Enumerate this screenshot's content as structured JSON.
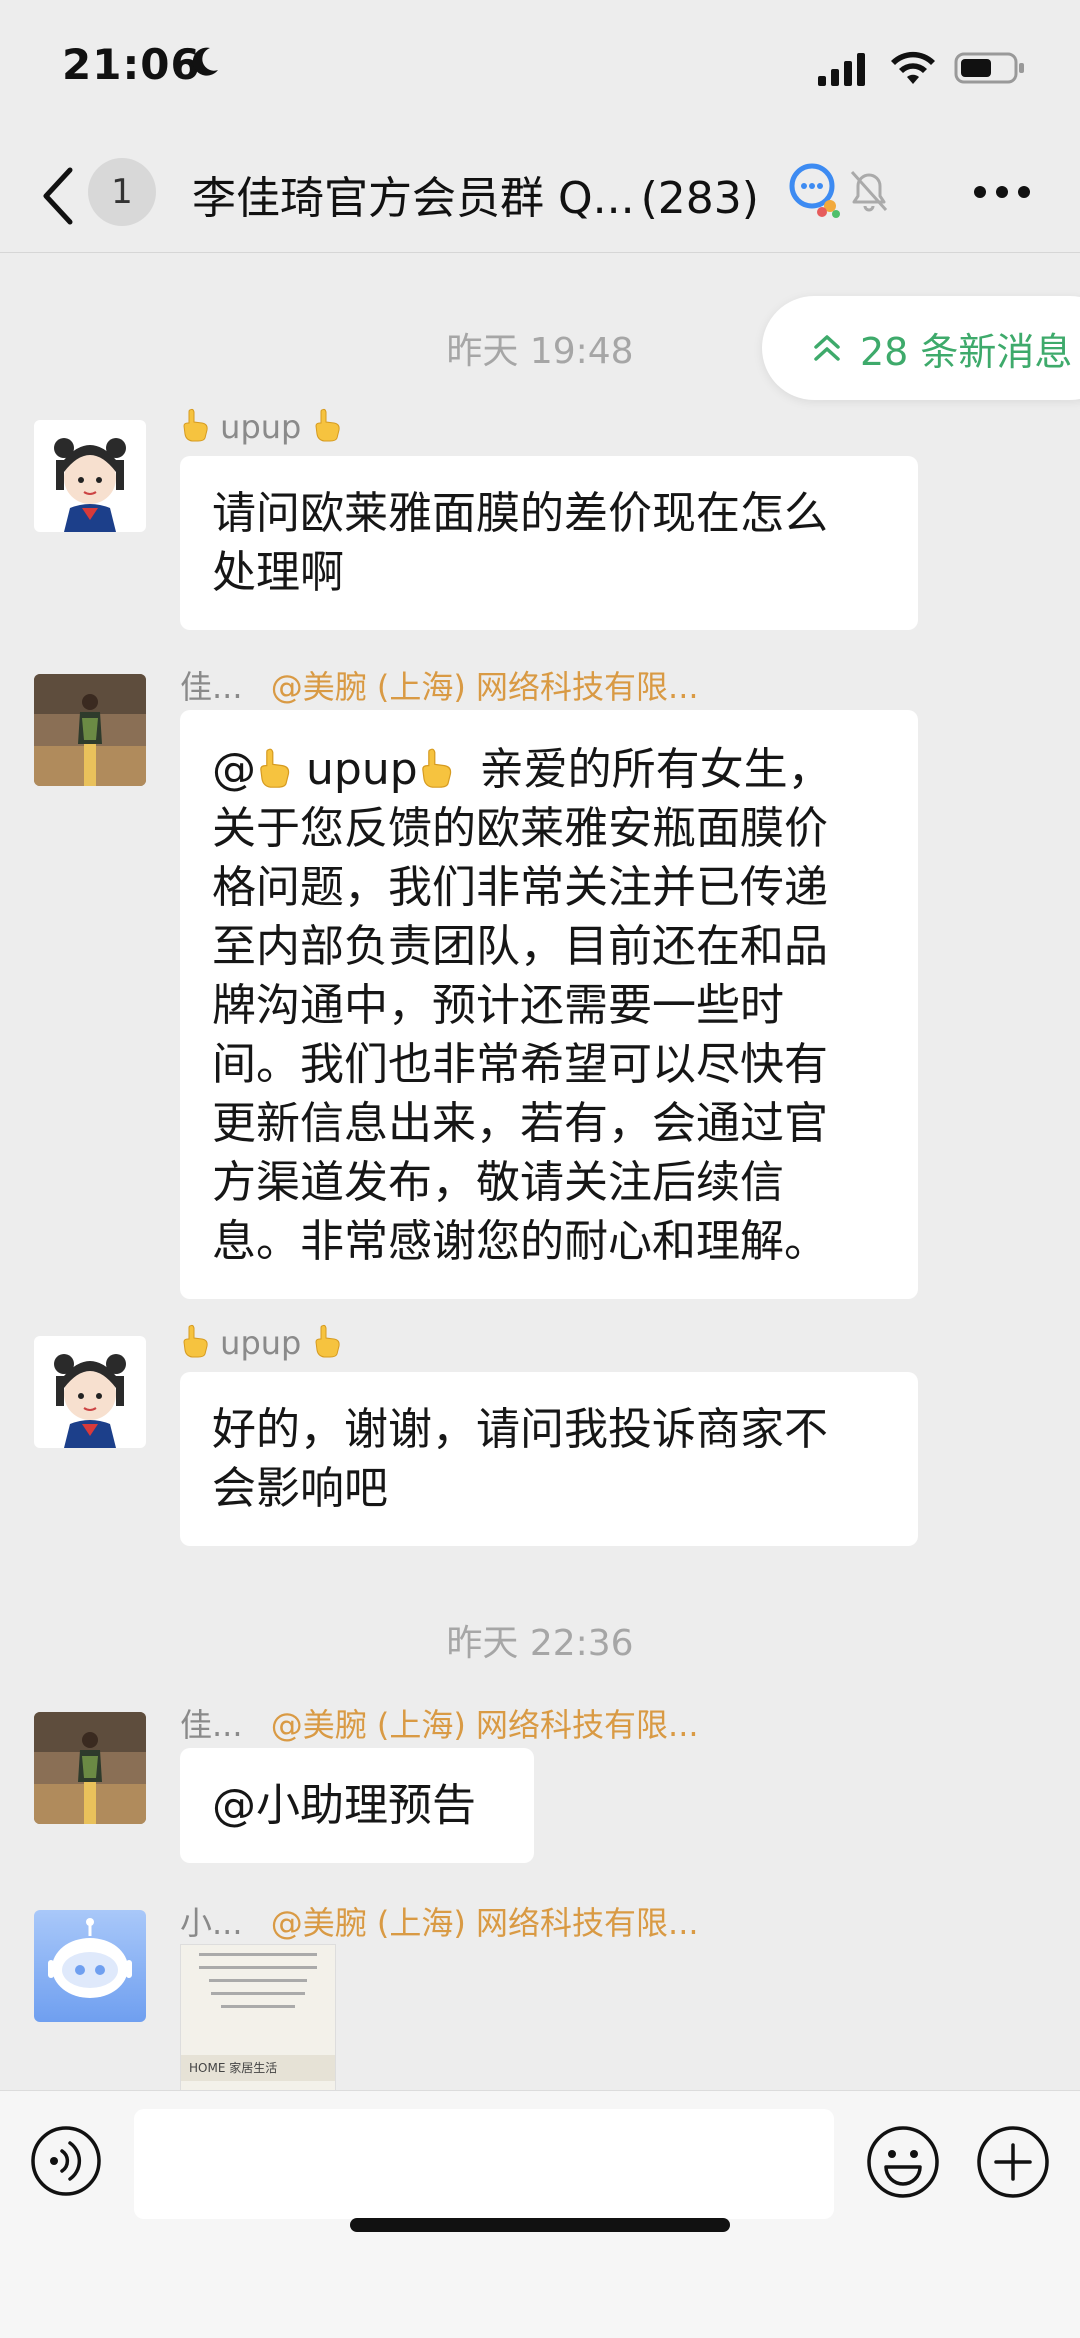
{
  "status_bar": {
    "time": "21:06",
    "icons": [
      "moon-icon",
      "signal-icon",
      "wifi-icon",
      "battery-icon"
    ]
  },
  "nav": {
    "unread_badge": "1",
    "title": "李佳琦官方会员群 Q...",
    "member_count": "(283)",
    "icons": [
      "back-icon",
      "group-chat-icon",
      "mute-icon",
      "more-icon"
    ]
  },
  "new_messages": {
    "label": "28 条新消息"
  },
  "timestamps": {
    "first": "昨天 19:48",
    "second": "昨天 22:36"
  },
  "messages": [
    {
      "sender": "upup",
      "text_line1": "请问欧莱雅面膜的差价现在怎么",
      "text_line2": "处理啊"
    },
    {
      "sender": "佳...",
      "org": "@美腕 (上海) 网络科技有限...",
      "mention": "@",
      "mention_name": "upup",
      "lines": [
        "亲爱的所有女生，",
        "关于您反馈的欧莱雅安瓶面膜价",
        "格问题，我们非常关注并已传递",
        "至内部负责团队，目前还在和品",
        "牌沟通中，预计还需要一些时",
        "间。我们也非常希望可以尽快有",
        "更新信息出来，若有，会通过官",
        "方渠道发布，敬请关注后续信",
        "息。非常感谢您的耐心和理解。"
      ]
    },
    {
      "sender": "upup",
      "text_line1": "好的，谢谢，请问我投诉商家不",
      "text_line2": "会影响吧"
    },
    {
      "sender": "佳...",
      "org": "@美腕 (上海) 网络科技有限...",
      "text": "@小助理预告"
    },
    {
      "sender": "小...",
      "org": "@美腕 (上海) 网络科技有限...",
      "image_caption": "HOME 家居生活"
    }
  ],
  "input": {
    "placeholder": ""
  },
  "colors": {
    "accent_green": "#3eaa6b",
    "org_orange": "#d99a44",
    "background": "#ededed"
  }
}
